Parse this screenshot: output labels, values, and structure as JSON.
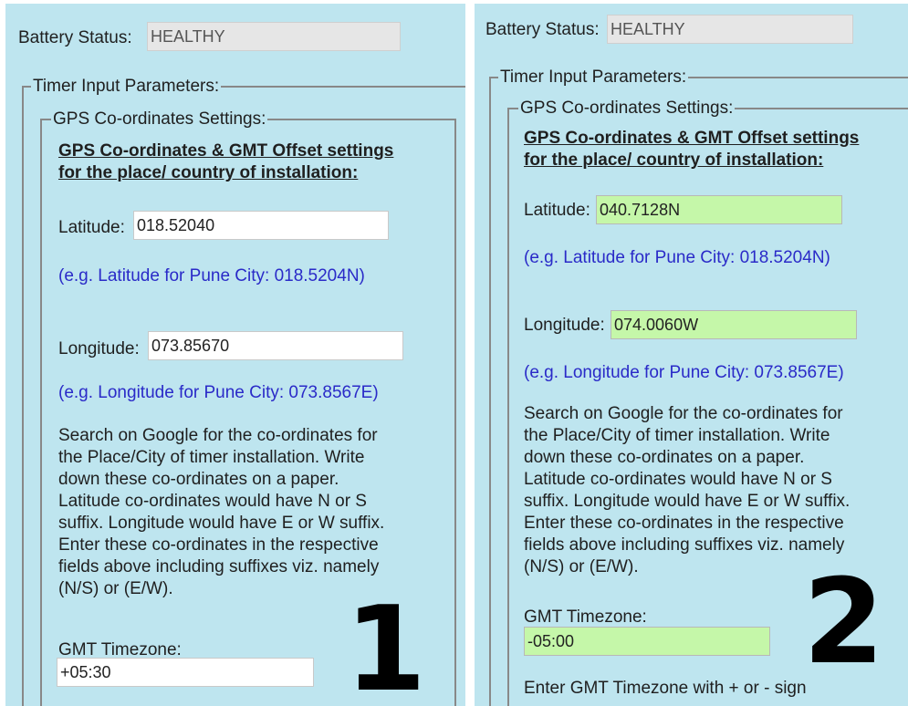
{
  "panels": [
    {
      "label": "1",
      "battery_status_label": "Battery Status:",
      "battery_status_value": "HEALTHY",
      "timer_input_legend": "Timer Input Parameters:",
      "gps_settings_legend": "GPS Co-ordinates Settings:",
      "gps_heading": "GPS Co-ordinates & GMT Offset settings\nfor the place/ country of installation:",
      "latitude_label": "Latitude:",
      "latitude_value": "018.52040",
      "latitude_example": "(e.g. Latitude for Pune City: 018.5204N)",
      "longitude_label": "Longitude:",
      "longitude_value": "073.85670",
      "longitude_example": "(e.g. Longitude for Pune City: 073.8567E)",
      "instructions": "Search on Google for the co-ordinates for\nthe Place/City of timer installation. Write\ndown these co-ordinates on a paper.\nLatitude co-ordinates would have N or S\nsuffix. Longitude would have E or W suffix.\nEnter these co-ordinates in the respective\nfields above including suffixes viz. namely\n(N/S) or (E/W).",
      "gmt_label": "GMT Timezone:",
      "gmt_value": "+05:30",
      "field_color": "#ffffff"
    },
    {
      "label": "2",
      "battery_status_label": "Battery Status:",
      "battery_status_value": "HEALTHY",
      "timer_input_legend": "Timer Input Parameters:",
      "gps_settings_legend": "GPS Co-ordinates Settings:",
      "gps_heading": "GPS Co-ordinates & GMT Offset settings\nfor the place/ country of installation:",
      "latitude_label": "Latitude:",
      "latitude_value": "040.7128N",
      "latitude_example": "(e.g. Latitude for Pune City: 018.5204N)",
      "longitude_label": "Longitude:",
      "longitude_value": "074.0060W",
      "longitude_example": "(e.g. Longitude for Pune City: 073.8567E)",
      "instructions": "Search on Google for the co-ordinates for\nthe Place/City of timer installation. Write\ndown these co-ordinates on a paper.\nLatitude co-ordinates would have N or S\nsuffix. Longitude would have E or W suffix.\nEnter these co-ordinates in the respective\nfields above including suffixes viz. namely\n(N/S) or (E/W).",
      "gmt_label": "GMT Timezone:",
      "gmt_value": "-05:00",
      "gmt_help": "Enter GMT Timezone with + or - sign",
      "field_color": "#c5f7a9"
    }
  ],
  "colors": {
    "panel_background": "#bee5ef",
    "example_text": "#2a2ac8",
    "readonly_field": "#e6e6e6",
    "valid_field": "#c5f7a9"
  }
}
